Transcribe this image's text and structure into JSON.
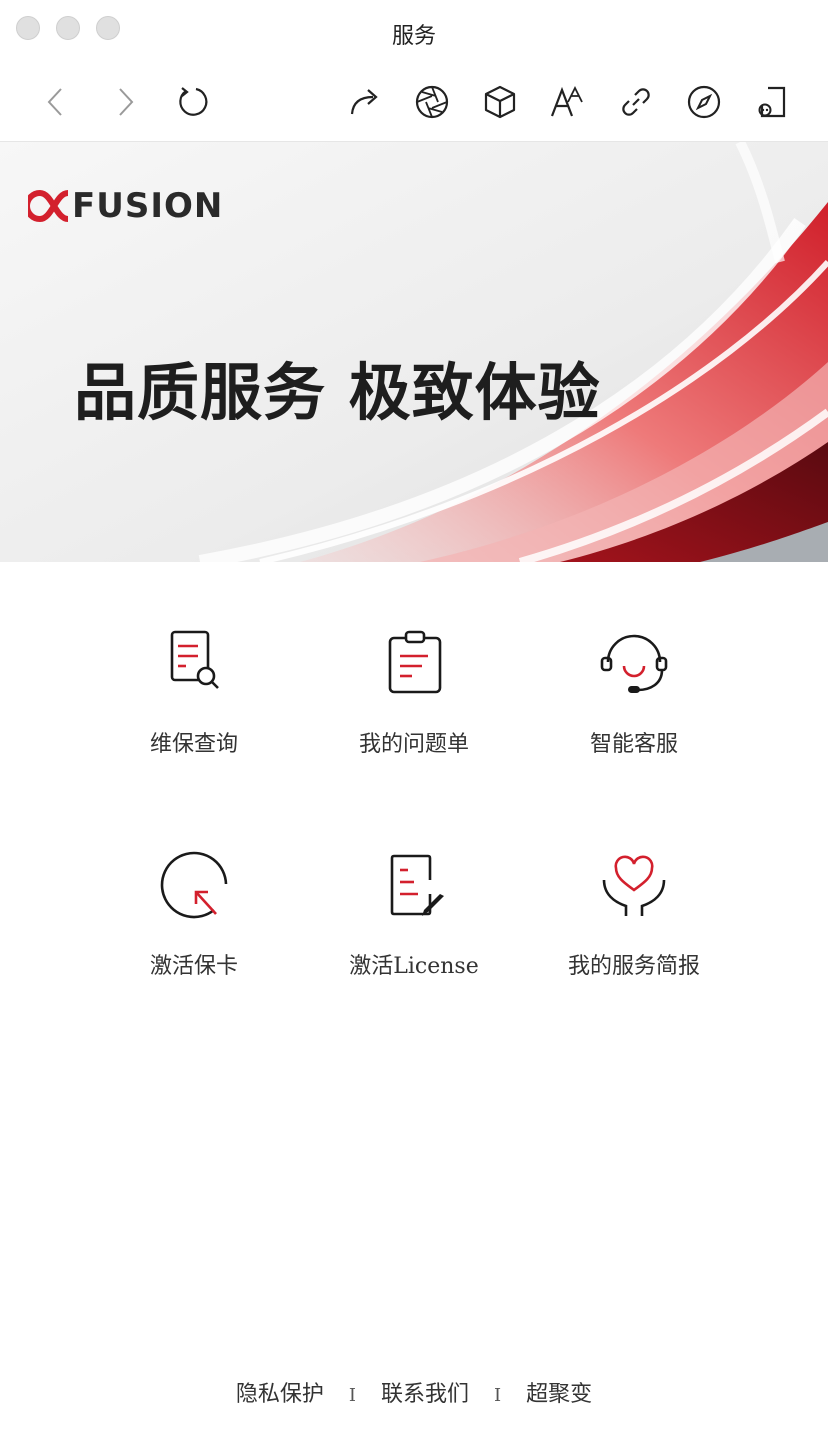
{
  "window": {
    "title": "服务"
  },
  "toolbar": {
    "icons": [
      "back-icon",
      "forward-icon",
      "refresh-icon",
      "share-icon",
      "aperture-icon",
      "cube-icon",
      "font-size-icon",
      "link-icon",
      "compass-icon",
      "mini-program-icon"
    ]
  },
  "banner": {
    "brand": "FUSION",
    "slogan": "品质服务 极致体验"
  },
  "services": [
    {
      "label": "维保查询",
      "icon": "document-search-icon"
    },
    {
      "label": "我的问题单",
      "icon": "clipboard-icon"
    },
    {
      "label": "智能客服",
      "icon": "headset-icon"
    },
    {
      "label": "激活保卡",
      "icon": "activate-arrow-icon"
    },
    {
      "label": "激活License",
      "icon": "document-edit-icon"
    },
    {
      "label": "我的服务简报",
      "icon": "heart-hands-icon"
    }
  ],
  "footer": {
    "privacy": "隐私保护",
    "contact": "联系我们",
    "brand_link": "超聚变",
    "separator": "I"
  },
  "colors": {
    "accent": "#d3202d",
    "icon_dark": "#1a1a1a"
  }
}
